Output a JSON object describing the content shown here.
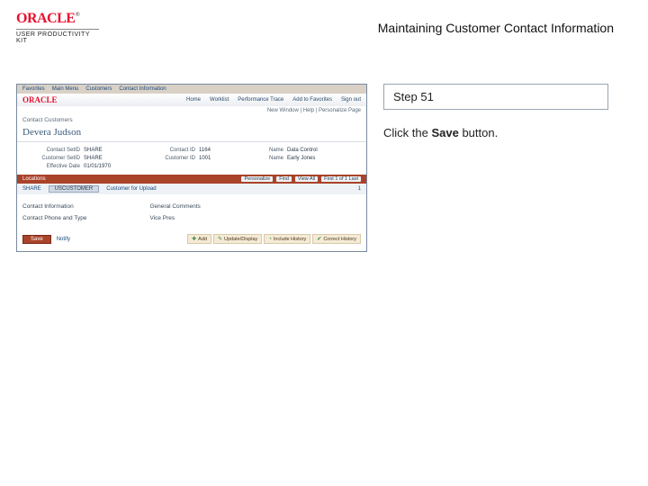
{
  "header": {
    "logo_text": "ORACLE",
    "logo_tm": "®",
    "subtitle": "USER PRODUCTIVITY KIT",
    "page_title": "Maintaining Customer Contact Information"
  },
  "instruction": {
    "step_label": "Step 51",
    "line_pre": "Click the ",
    "line_bold": "Save",
    "line_post": " button."
  },
  "shot": {
    "nav": {
      "items": [
        "Favorites",
        "Main Menu",
        "Customers",
        "Contact Information"
      ]
    },
    "oracle_label": "ORACLE",
    "top_menu": [
      "Home",
      "Worklist",
      "Performance Trace",
      "Add to Favorites",
      "Sign out"
    ],
    "meta_line": "New Window | Help | Personalize Page",
    "breadcrumb": "Contact Customers",
    "heading": "Devera Judson",
    "fields": {
      "r1": {
        "l1": "Contact SetID",
        "v1": "SHARE",
        "l2": "Contact ID",
        "v2": "1164",
        "l3": "Name",
        "v3": "Data Control"
      },
      "r2": {
        "l1": "Customer SetID",
        "v1": "SHARE",
        "l2": "Customer ID",
        "v2": "1001",
        "l3": "Name",
        "v3": "Early Jones"
      },
      "r3": {
        "l1": "Effective Date",
        "v1": "01/01/1970"
      }
    },
    "section": {
      "label": "Locations",
      "tools": [
        "Personalize",
        "Find",
        "View All"
      ],
      "counter": "First 1 of 1 Last"
    },
    "row": {
      "col1": "SHARE",
      "select_value": "USCUSTOMER",
      "desc": "Customer for Upload"
    },
    "two_col": {
      "left_h": "Contact Information",
      "left_v": "Contact Phone and Type",
      "right_h": "General Comments",
      "right_v": "Vice Pres"
    },
    "bottom": {
      "save_label": "Save",
      "notify_label": "Notify",
      "tabs": [
        "Add",
        "Update/Display",
        "Include History",
        "Correct History"
      ]
    }
  }
}
